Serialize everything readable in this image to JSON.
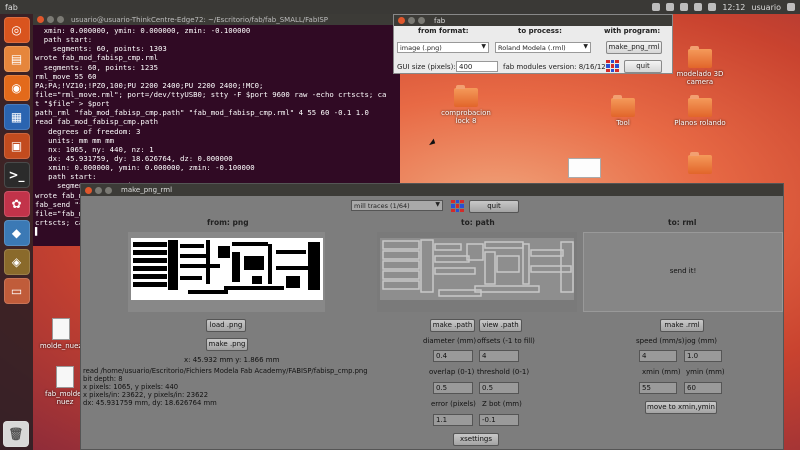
{
  "topbar": {
    "title": "fab",
    "time": "12:12",
    "user": "usuario"
  },
  "launcher": {
    "items": [
      {
        "name": "ubuntu-icon",
        "glyph": "◎",
        "color": "#d9541e"
      },
      {
        "name": "files-icon",
        "glyph": "▤",
        "color": "#e6863c"
      },
      {
        "name": "firefox-icon",
        "glyph": "◉",
        "color": "#e36a1b"
      },
      {
        "name": "writer-icon",
        "glyph": "▦",
        "color": "#2a64b0"
      },
      {
        "name": "impress-icon",
        "glyph": "▣",
        "color": "#c24b1e"
      },
      {
        "name": "terminal-icon",
        "glyph": ">_",
        "color": "#2b2b2b"
      },
      {
        "name": "settings-icon",
        "glyph": "✿",
        "color": "#c2334a"
      },
      {
        "name": "python-icon",
        "glyph": "◆",
        "color": "#3b79b5"
      },
      {
        "name": "tool-icon",
        "glyph": "◈",
        "color": "#8a6a2b"
      },
      {
        "name": "window-icon",
        "glyph": "▭",
        "color": "#c05c3a"
      }
    ],
    "trash_glyph": "🗑"
  },
  "terminal": {
    "title": "usuario@usuario-ThinkCentre-Edge72: ~/Escritorio/fab/fab_SMALL/FabISP",
    "lines": [
      "  xmin: 0.000000, ymin: 0.000000, zmin: -0.100000",
      "  path start:",
      "    segments: 60, points: 1303",
      "wrote fab_mod_fabisp_cmp.rml",
      "  segments: 60, points: 1235",
      "rml_move 55 60",
      "PA;PA;!VZ10;!PZ0,100;PU 2200 2400;PU 2200 2400;!MC0;",
      "file=\"rml_move.rml\"; port=/dev/ttyUSB0; stty -F $port 9600 raw -echo crtscts; ca",
      "t \"$file\" > $port",
      "path_rml \"fab_mod_fabisp_cmp.path\" \"fab_mod_fabisp_cmp.rml\" 4 55 60 -0.1 1.0",
      "read fab_mod_fabisp_cmp.path",
      "   degrees of freedom: 3",
      "   units: mm mm mm",
      "   nx: 1065, ny: 440, nz: 1",
      "   dx: 45.931759, dy: 18.626764, dz: 0.000000",
      "   xmin: 0.000000, ymin: 0.000000, zmin: -0.100000",
      "   path start:",
      "     segments: 60, points: 1235",
      "wrote fab_mod_fabisp_cmp.rml",
      "fab_send \"fab_mod_fabisp_cmp.rml\"",
      "file=\"fab_mod_fabisp_cmp.rml\"; port=/dev/ttyUSB0; stty -F $port 9600 raw -echo",
      "crtscts; cat \"$file\" > $port",
      "▌"
    ]
  },
  "fab": {
    "title": "fab",
    "from_format_label": "from format:",
    "to_process_label": "to process:",
    "with_program_label": "with program:",
    "from_format_value": "image (.png)",
    "to_process_value": "Roland Modela (.rml)",
    "program_button": "make_png_rml",
    "gui_size_label": "GUI size (pixels):",
    "gui_size_value": "400",
    "version_label": "fab modules version: 8/16/12",
    "quit_label": "quit"
  },
  "desktop": {
    "icons": [
      {
        "name": "folder-modelado",
        "label": "modelado 3D\ncamera",
        "type": "folder"
      },
      {
        "name": "folder-comprobacion",
        "label": "comprobacion\nlock 8",
        "type": "folder"
      },
      {
        "name": "folder-tool",
        "label": "Tool",
        "type": "folder"
      },
      {
        "name": "folder-planos",
        "label": "Planos rolando",
        "type": "folder"
      },
      {
        "name": "folder-right",
        "label": "",
        "type": "folder"
      },
      {
        "name": "file-molde",
        "label": "molde_nuez",
        "type": "doc"
      },
      {
        "name": "file-fab-molde",
        "label": "fab_molde_\nnuez",
        "type": "doc"
      }
    ]
  },
  "pngwin": {
    "title": "make_png_rml",
    "mode_value": "mill traces (1/64)",
    "quit_label": "quit",
    "from_png_label": "from: png",
    "to_path_label": "to: path",
    "to_rml_label": "to: rml",
    "load_png": "load .png",
    "make_png": "make .png",
    "scale_text": "x: 45.932 mm  y: 1.866 mm",
    "info_lines": [
      "read /home/usuario/Escritorio/Fichiers Modela Fab Academy/FABISP/fabisp_cmp.png",
      "   bit depth: 8",
      "   x pixels: 1065, y pixels: 440",
      "   x pixels/in: 23622, y pixels/in: 23622",
      "   dx: 45.931759 mm, dy: 18.626764 mm"
    ],
    "make_path": "make .path",
    "view_path": "view .path",
    "diameter_label": "diameter (mm)",
    "diameter_value": "0.4",
    "offsets_label": "offsets (-1 to fill)",
    "offsets_value": "4",
    "overlap_label": "overlap (0-1)",
    "overlap_value": "0.5",
    "threshold_label": "threshold (0-1)",
    "threshold_value": "0.5",
    "error_label": "error (pixels)",
    "error_value": "1.1",
    "zbot_label": "Z bot (mm)",
    "zbot_value": "-0.1",
    "xsettings": "xsettings",
    "send_it": "send it!",
    "make_rml": "make .rml",
    "speed_label": "speed (mm/s)",
    "speed_value": "4",
    "jog_label": "jog (mm)",
    "jog_value": "1.0",
    "xmin_label": "xmin (mm)",
    "xmin_value": "55",
    "ymin_label": "ymin (mm)",
    "ymin_value": "60",
    "move_label": "move to xmin,ymin"
  },
  "colors": {
    "terminal_bg": "#300a24",
    "titlebar": "#3c3b37",
    "accent_orange": "#e86a45"
  }
}
